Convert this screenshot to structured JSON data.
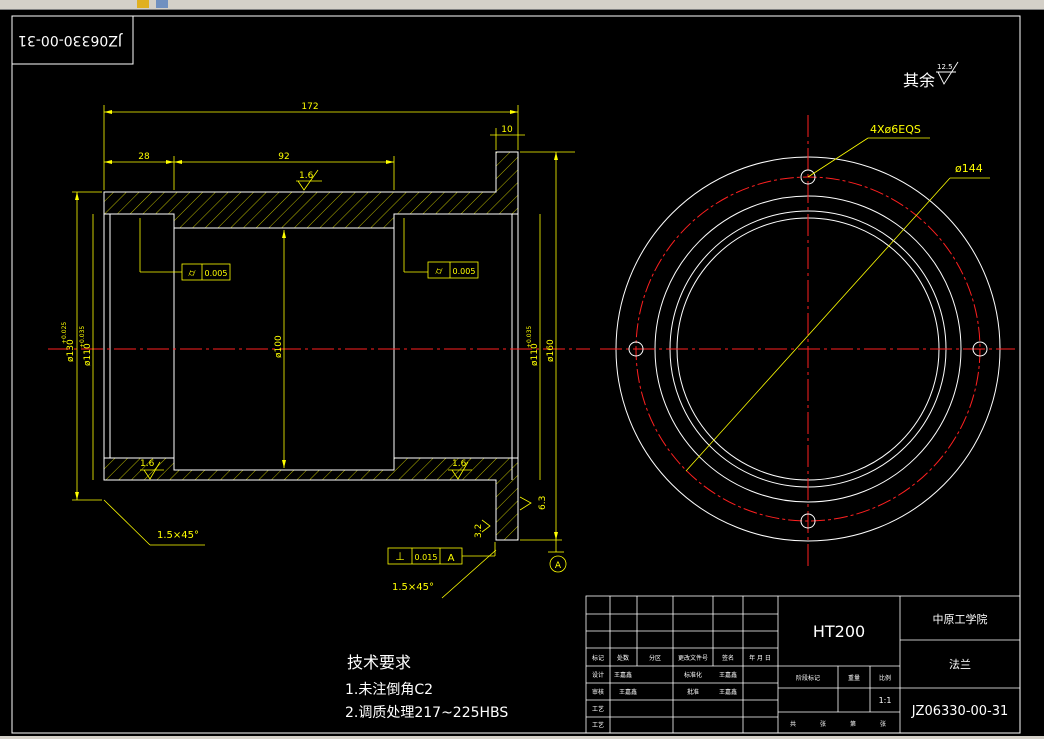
{
  "toolbar": {
    "icons": [
      "layer-tool-icon",
      "properties-tool-icon"
    ]
  },
  "colors": {
    "outline": "#ffffff",
    "dimension": "#ffff00",
    "center": "#ff0000",
    "hatch": "#ffff00"
  },
  "drawing": {
    "code_box": "JZ06330-00-31",
    "surface_note": {
      "text": "其余",
      "roughness": "12.5"
    },
    "dimensions": {
      "overall_length": "172",
      "flange_width": "10",
      "left_step": "28",
      "middle": "92",
      "bore": "ø100",
      "outer_left": "ø130",
      "outer_left_tol_top": "+0.025",
      "outer_left_tol_bottom": "+0.003",
      "inner_left": "ø110",
      "inner_left_tol": "+0.035",
      "inner_right": "ø110",
      "inner_right_tol": "+0.035",
      "flange_dia": "ø160",
      "chamfer_top": "1.5×45°",
      "chamfer_bottom": "1.5×45°",
      "bolt_circle": "ø144",
      "holes": "4Xø6EQS"
    },
    "roughness": {
      "top_mid": "1.6",
      "bottom_left": "1.6",
      "bottom_right": "1.6",
      "flange_face": "6.3",
      "flange_bottom": "3.2"
    },
    "tolerance_frames": {
      "left": {
        "symbol": "⌭",
        "value": "0.005"
      },
      "right": {
        "symbol": "⌭",
        "value": "0.005"
      },
      "perp": {
        "symbol": "⊥",
        "value": "0.015",
        "datum": "A"
      }
    },
    "datum_label": "A",
    "tech_req": {
      "title": "技术要求",
      "line1": "1.未注倒角C2",
      "line2": "2.调质处理217~225HBS"
    }
  },
  "title_block": {
    "material": "HT200",
    "school": "中原工学院",
    "part_name": "法兰",
    "drawing_no": "JZ06330-00-31",
    "scale": "1:1",
    "row_labels": [
      "标记",
      "处数",
      "分区",
      "更改文件号",
      "签名",
      "年 月 日"
    ],
    "design": "设计",
    "design_std": "标准化",
    "review": "审核",
    "process": "工艺",
    "approve": "批准",
    "signer": "王嘉鑫",
    "stage_mark": "阶段标记",
    "weight": "重量",
    "ratio": "比例",
    "sheets_1": "共",
    "sheets_2": "张",
    "sheets_3": "第",
    "sheets_4": "张"
  }
}
